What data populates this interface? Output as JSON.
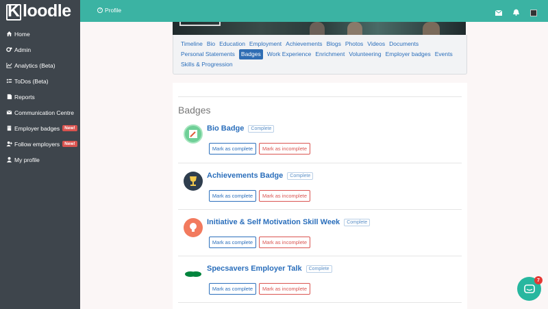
{
  "app": {
    "logo_first": "K",
    "logo_rest": "loodle"
  },
  "sidebar": {
    "items": [
      {
        "label": "Home",
        "icon": "home-icon"
      },
      {
        "label": "Admin",
        "icon": "cogs-icon"
      },
      {
        "label": "Analytics (Beta)",
        "icon": "chart-icon"
      },
      {
        "label": "ToDos (Beta)",
        "icon": "checklist-icon"
      },
      {
        "label": "Reports",
        "icon": "document-icon"
      },
      {
        "label": "Communication Centre",
        "icon": "envelope-icon"
      },
      {
        "label": "Employer badges",
        "icon": "building-icon",
        "badge": "New!"
      },
      {
        "label": "Follow employers",
        "icon": "user-plus-icon",
        "badge": "New!"
      },
      {
        "label": "My profile",
        "icon": "user-icon"
      }
    ]
  },
  "topbar": {
    "profile_label": "Profile",
    "accent": "#3bb3a3"
  },
  "tabs": [
    "Timeline",
    "Bio",
    "Education",
    "Employment",
    "Achievements",
    "Blogs",
    "Photos",
    "Videos",
    "Documents",
    "Personal Statements",
    "Badges",
    "Work Experience",
    "Enrichment",
    "Volunteering",
    "Employer badges",
    "Events",
    "Skills & Progression"
  ],
  "active_tab": "Badges",
  "main": {
    "title": "Badges",
    "complete_label": "Mark as complete",
    "incomplete_label": "Mark as incomplete",
    "badges": [
      {
        "name": "Bio Badge",
        "status": "Complete",
        "icon": "pencil-icon",
        "color": "#6fcf97"
      },
      {
        "name": "Achievements Badge",
        "status": "Complete",
        "icon": "trophy-icon",
        "color": "#2f3e4e"
      },
      {
        "name": "Initiative & Self Motivation Skill Week",
        "status": "Complete",
        "icon": "lightbulb-icon",
        "color": "#f27a5e"
      },
      {
        "name": "Specsavers Employer Talk",
        "status": "Complete",
        "icon": "specsavers-logo",
        "color": "#00843d"
      }
    ]
  },
  "chat": {
    "unread": "7"
  }
}
